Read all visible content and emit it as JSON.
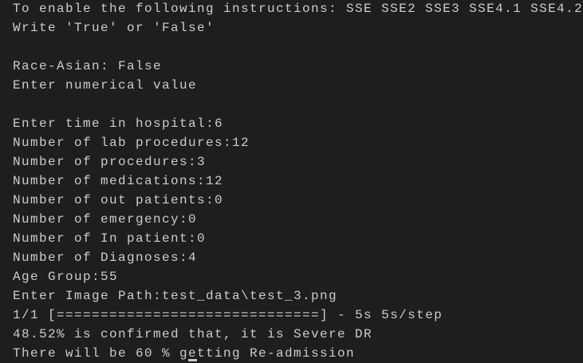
{
  "terminal": {
    "lines": [
      "To enable the following instructions: SSE SSE2 SSE3 SSE4.1 SSE4.2",
      "Write 'True' or 'False'",
      "",
      "Race-Asian: False",
      "Enter numerical value",
      "",
      "Enter time in hospital:6",
      "Number of lab procedures:12",
      "Number of procedures:3",
      "Number of medications:12",
      "Number of out patients:0",
      "Number of emergency:0",
      "Number of In patient:0",
      "Number of Diagnoses:4",
      "Age Group:55",
      "Enter Image Path:test_data\\test_3.png",
      "1/1 [==============================] - 5s 5s/step",
      "48.52% is confirmed that, it is Severe DR",
      "There will be 60 % getting Re-admission"
    ],
    "colors": {
      "background": "#1e1e1e",
      "text": "#cccccc"
    }
  }
}
